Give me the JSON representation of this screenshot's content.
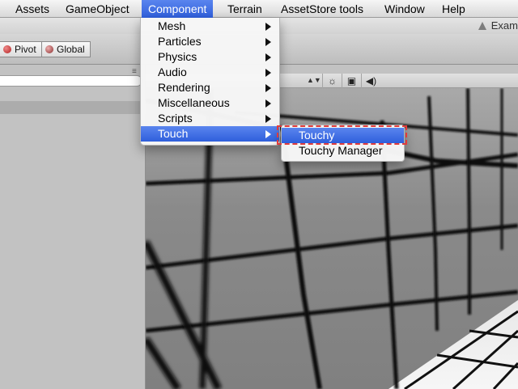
{
  "menubar": {
    "items": [
      "Assets",
      "GameObject",
      "Component",
      "Terrain",
      "AssetStore tools",
      "Window",
      "Help"
    ],
    "active": "Component"
  },
  "window": {
    "title": "Exam"
  },
  "toolbar": {
    "pivot_label": "Pivot",
    "global_label": "Global"
  },
  "scene_header": {
    "icons": [
      "sun-icon",
      "image-icon",
      "speaker-icon"
    ]
  },
  "component_menu": {
    "items": [
      {
        "label": "Mesh",
        "submenu": true
      },
      {
        "label": "Particles",
        "submenu": true
      },
      {
        "label": "Physics",
        "submenu": true
      },
      {
        "label": "Audio",
        "submenu": true
      },
      {
        "label": "Rendering",
        "submenu": true
      },
      {
        "label": "Miscellaneous",
        "submenu": true
      },
      {
        "label": "Scripts",
        "submenu": true
      },
      {
        "label": "Touch",
        "submenu": true
      }
    ],
    "active": "Touch"
  },
  "touch_submenu": {
    "items": [
      "Touchy",
      "Touchy Manager"
    ],
    "active": "Touchy"
  },
  "colors": {
    "menu_highlight": "#3a6be6",
    "annotation_border": "#e23b3b",
    "grid_line": "#111111"
  }
}
